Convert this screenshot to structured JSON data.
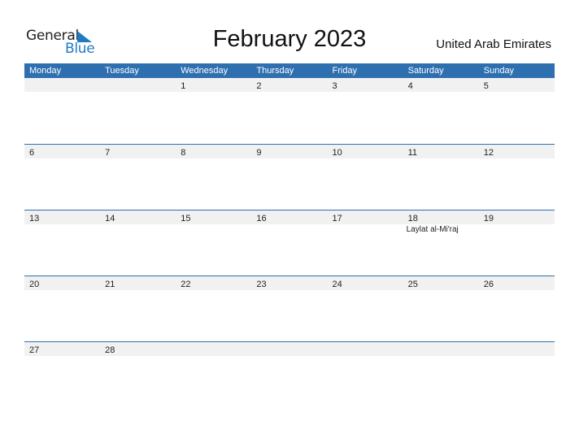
{
  "logo": {
    "word1": "General",
    "word2": "Blue",
    "brand_color": "#1f7bc1"
  },
  "title": "February 2023",
  "country": "United Arab Emirates",
  "header_color": "#2e6fb0",
  "weekdays": [
    "Monday",
    "Tuesday",
    "Wednesday",
    "Thursday",
    "Friday",
    "Saturday",
    "Sunday"
  ],
  "weeks": [
    {
      "days": [
        "",
        "",
        "1",
        "2",
        "3",
        "4",
        "5"
      ],
      "events": [
        "",
        "",
        "",
        "",
        "",
        "",
        ""
      ]
    },
    {
      "days": [
        "6",
        "7",
        "8",
        "9",
        "10",
        "11",
        "12"
      ],
      "events": [
        "",
        "",
        "",
        "",
        "",
        "",
        ""
      ]
    },
    {
      "days": [
        "13",
        "14",
        "15",
        "16",
        "17",
        "18",
        "19"
      ],
      "events": [
        "",
        "",
        "",
        "",
        "",
        "Laylat al-Mi'raj",
        ""
      ]
    },
    {
      "days": [
        "20",
        "21",
        "22",
        "23",
        "24",
        "25",
        "26"
      ],
      "events": [
        "",
        "",
        "",
        "",
        "",
        "",
        ""
      ]
    },
    {
      "days": [
        "27",
        "28",
        "",
        "",
        "",
        "",
        ""
      ],
      "events": [
        "",
        "",
        "",
        "",
        "",
        "",
        ""
      ]
    }
  ]
}
